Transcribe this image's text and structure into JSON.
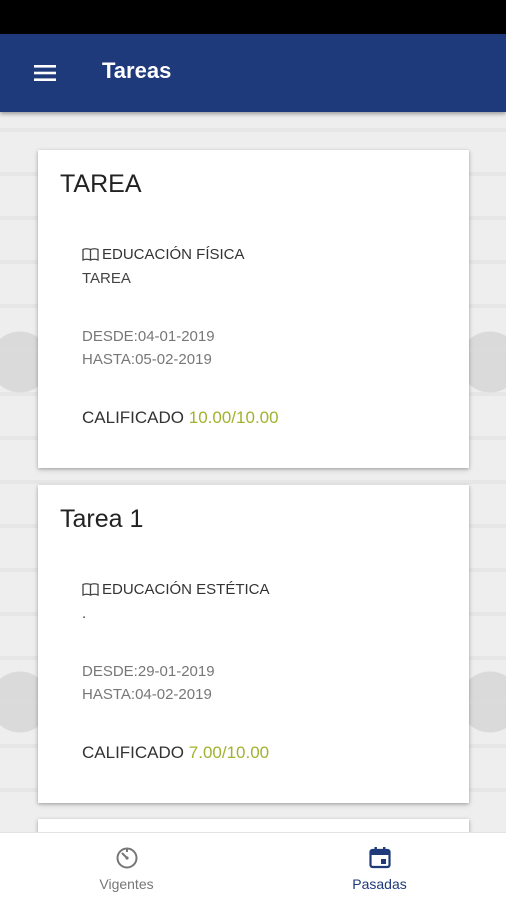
{
  "app_bar": {
    "title": "Tareas",
    "menu_icon": "menu-icon"
  },
  "colors": {
    "primary": "#1f3a7a",
    "grade": "#a2b22e",
    "nav_active": "#1f3a7a",
    "nav_inactive": "#777777"
  },
  "tasks": [
    {
      "title": "TAREA",
      "subject": "EDUCACIÓN FÍSICA",
      "type": "TAREA",
      "from": "DESDE:04-01-2019",
      "to": "HASTA:05-02-2019",
      "status": "CALIFICADO",
      "grade": "10.00/10.00"
    },
    {
      "title": "Tarea 1",
      "subject": "EDUCACIÓN ESTÉTICA",
      "type": ".",
      "from": "DESDE:29-01-2019",
      "to": "HASTA:04-02-2019",
      "status": "CALIFICADO",
      "grade": "7.00/10.00"
    }
  ],
  "bottom_nav": {
    "items": [
      {
        "label": "Vigentes",
        "icon": "timer-icon",
        "active": false
      },
      {
        "label": "Pasadas",
        "icon": "calendar-icon",
        "active": true
      }
    ]
  }
}
